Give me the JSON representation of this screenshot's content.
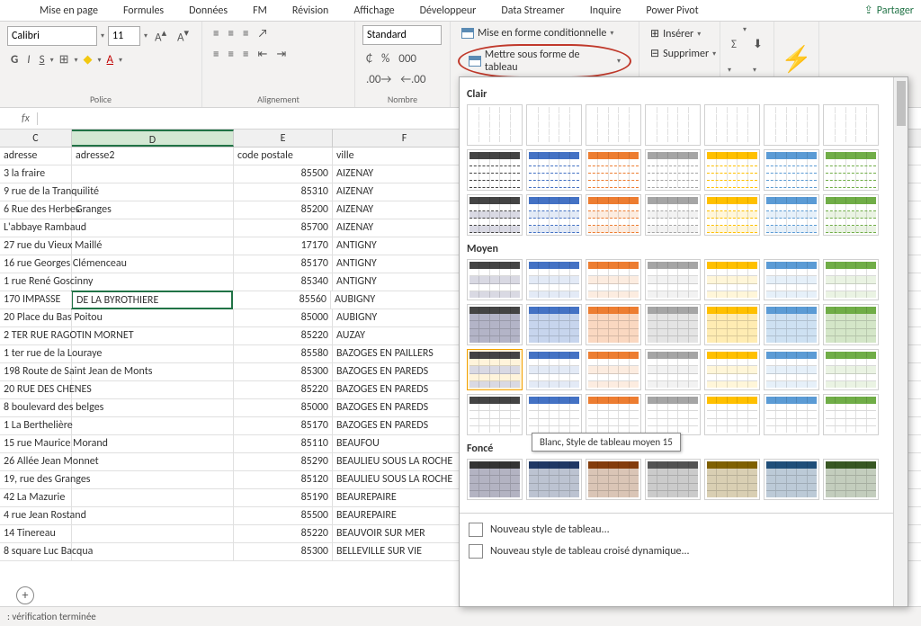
{
  "tabs": [
    "Mise en page",
    "Formules",
    "Données",
    "FM",
    "Révision",
    "Affichage",
    "Développeur",
    "Data Streamer",
    "Inquire",
    "Power Pivot"
  ],
  "share": "Partager",
  "font": {
    "name": "Calibri",
    "size": "11",
    "groupLabel": "Police"
  },
  "alignGroup": "Alignement",
  "numberGroup": "Nombre",
  "numberFormat": "Standard",
  "styles": {
    "conditional": "Mise en forme conditionnelle",
    "formatTable": "Mettre sous forme de tableau"
  },
  "cells": {
    "insert": "Insérer",
    "delete": "Supprimer"
  },
  "ideas": "Idées",
  "columns": [
    "C",
    "D",
    "E",
    "F"
  ],
  "headerRow": {
    "C": "adresse",
    "D": "adresse2",
    "E": "code postale",
    "F": "ville"
  },
  "selected": {
    "D": "DE LA BYROTHIERE"
  },
  "rows": [
    {
      "C": "3 la fraire",
      "D": "",
      "E": "85500",
      "F": "AIZENAY"
    },
    {
      "C": "9 rue de la Tranquilité",
      "D": "",
      "E": "85310",
      "F": "AIZENAY"
    },
    {
      "C": "6 Rue des Herbes",
      "D": "Granges",
      "E": "85200",
      "F": "AIZENAY"
    },
    {
      "C": "L'abbaye Rambaud",
      "D": "",
      "E": "85700",
      "F": "AIZENAY"
    },
    {
      "C": "27 rue du Vieux Maillé",
      "D": "",
      "E": "17170",
      "F": "ANTIGNY"
    },
    {
      "C": "16 rue Georges Clémenceau",
      "D": "",
      "E": "85170",
      "F": "ANTIGNY"
    },
    {
      "C": "1 rue René Goscinny",
      "D": "",
      "E": "85340",
      "F": "ANTIGNY"
    },
    {
      "C": "170 IMPASSE",
      "D": "DE LA BYROTHIERE",
      "E": "85560",
      "F": "AUBIGNY"
    },
    {
      "C": "20 Place du Bas Poitou",
      "D": "",
      "E": "85000",
      "F": "AUBIGNY"
    },
    {
      "C": "2 TER RUE RAGOTIN MORNET",
      "D": "",
      "E": "85220",
      "F": "AUZAY"
    },
    {
      "C": "1 ter rue de la Louraye",
      "D": "",
      "E": "85580",
      "F": "BAZOGES EN PAILLERS"
    },
    {
      "C": "198 Route de Saint Jean de Monts",
      "D": "",
      "E": "85300",
      "F": "BAZOGES EN PAREDS"
    },
    {
      "C": "20 RUE DES CHENES",
      "D": "",
      "E": "85220",
      "F": "BAZOGES EN PAREDS"
    },
    {
      "C": "8 boulevard des belges",
      "D": "",
      "E": "85000",
      "F": "BAZOGES EN PAREDS"
    },
    {
      "C": "1 La Berthelière",
      "D": "",
      "E": "85170",
      "F": "BAZOGES EN PAREDS"
    },
    {
      "C": "15 rue Maurice Morand",
      "D": "",
      "E": "85110",
      "F": "BEAUFOU"
    },
    {
      "C": "26 Allée Jean Monnet",
      "D": "",
      "E": "85290",
      "F": "BEAULIEU SOUS LA ROCHE"
    },
    {
      "C": "19, rue des Granges",
      "D": "",
      "E": "85120",
      "F": "BEAULIEU SOUS LA ROCHE"
    },
    {
      "C": "42 La Mazurie",
      "D": "",
      "E": "85190",
      "F": "BEAUREPAIRE"
    },
    {
      "C": "4 rue Jean Rostand",
      "D": "",
      "E": "85500",
      "F": "BEAUREPAIRE"
    },
    {
      "C": "14 Tinereau",
      "D": "",
      "E": "85220",
      "F": "BEAUVOIR SUR MER"
    },
    {
      "C": "8 square Luc Bacqua",
      "D": "",
      "E": "85300",
      "F": "BELLEVILLE SUR VIE"
    }
  ],
  "gallery": {
    "sections": [
      "Clair",
      "Moyen",
      "Foncé"
    ],
    "tooltip": "Blanc, Style de tableau moyen 15",
    "newStyle": "Nouveau style de tableau...",
    "newPivotStyle": "Nouveau style de tableau croisé dynamique...",
    "clairColors": [
      "#444",
      "#4472c4",
      "#ed7d31",
      "#a5a5a5",
      "#ffc000",
      "#5b9bd5",
      "#70ad47"
    ],
    "moyenColors": [
      "#444",
      "#4472c4",
      "#ed7d31",
      "#a5a5a5",
      "#ffc000",
      "#5b9bd5",
      "#70ad47"
    ],
    "fonceColors": [
      "#333",
      "#203864",
      "#843c0c",
      "#525252",
      "#7f6000",
      "#1f4e79",
      "#385723"
    ]
  },
  "status": ": vérification terminée"
}
